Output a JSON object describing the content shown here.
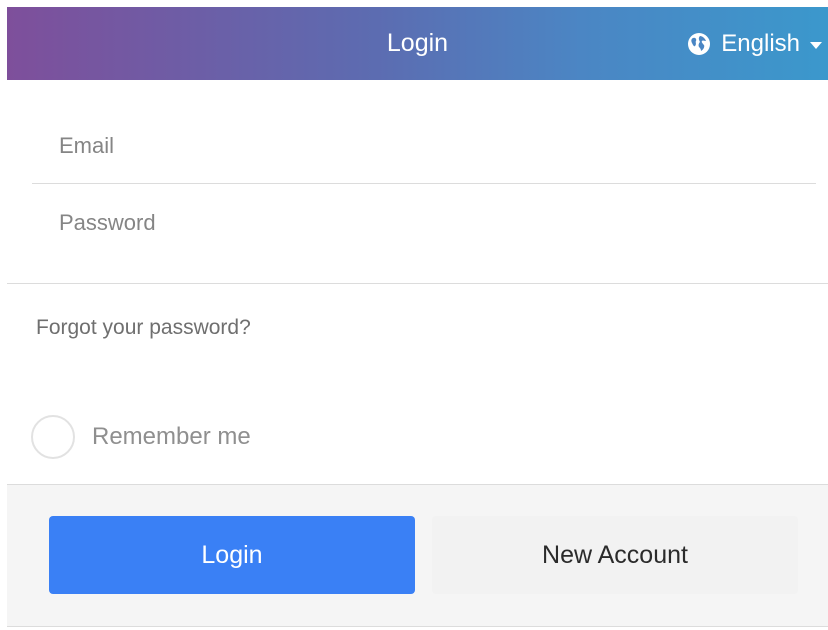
{
  "header": {
    "title": "Login",
    "language": "English",
    "language_icon": "globe-icon"
  },
  "form": {
    "email_placeholder": "Email",
    "email_value": "",
    "password_placeholder": "Password",
    "password_value": "",
    "forgot_link": "Forgot your password?",
    "remember_label": "Remember me",
    "remember_checked": false
  },
  "actions": {
    "login_label": "Login",
    "new_account_label": "New Account"
  },
  "colors": {
    "header_gradient_start": "#7e4f9b",
    "header_gradient_end": "#3b98cc",
    "login_button": "#3a80f5",
    "secondary_button": "#f2f2f2"
  }
}
